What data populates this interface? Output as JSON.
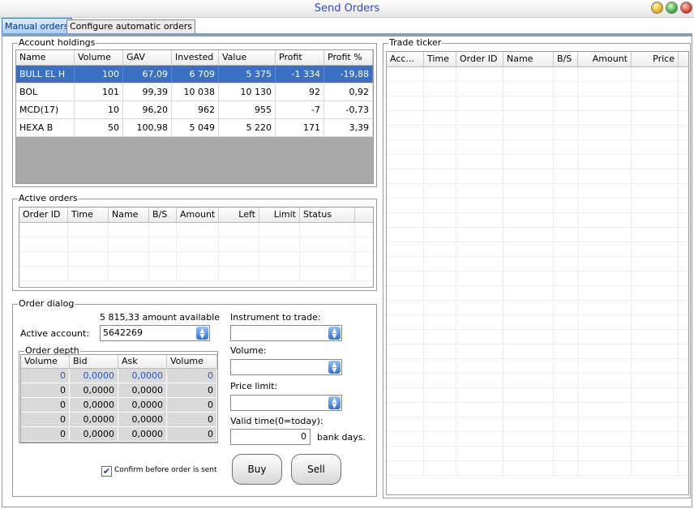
{
  "window": {
    "title": "Send Orders"
  },
  "tabs": [
    {
      "label": "Manual orders",
      "active": true
    },
    {
      "label": "Configure automatic orders",
      "active": false
    }
  ],
  "holdings": {
    "legend": "Account holdings",
    "columns": [
      "Name",
      "Volume",
      "GAV",
      "Invested",
      "Value",
      "Profit",
      "Profit %"
    ],
    "rows": [
      [
        "BULL EL H",
        "100",
        "67,09",
        "6 709",
        "5 375",
        "-1 334",
        "-19,88"
      ],
      [
        "BOL",
        "101",
        "99,39",
        "10 038",
        "10 130",
        "92",
        "0,92"
      ],
      [
        "MCD(17)",
        "10",
        "96,20",
        "962",
        "955",
        "-7",
        "-0,73"
      ],
      [
        "HEXA B",
        "50",
        "100,98",
        "5 049",
        "5 220",
        "171",
        "3,39"
      ]
    ],
    "selected_row": 0
  },
  "active_orders": {
    "legend": "Active orders",
    "columns": [
      "Order ID",
      "Time",
      "Name",
      "B/S",
      "Amount",
      "Left",
      "Limit",
      "Status"
    ]
  },
  "order_dialog": {
    "legend": "Order dialog",
    "available_text": "5 815,33 amount available",
    "account_label": "Active account:",
    "account_value": "5642269",
    "instrument_label": "Instrument to trade:",
    "instrument_value": "",
    "volume_label": "Volume:",
    "volume_value": "",
    "price_limit_label": "Price limit:",
    "price_limit_value": "",
    "valid_time_label": "Valid time(0=today):",
    "valid_time_value": "0",
    "bank_days_label": "bank days.",
    "confirm_label": "Confirm before order is sent",
    "confirm_checked": true,
    "buy_label": "Buy",
    "sell_label": "Sell",
    "depth": {
      "legend": "Order depth",
      "columns": [
        "Volume",
        "Bid",
        "Ask",
        "Volume"
      ],
      "rows": [
        [
          "0",
          "0,0000",
          "0,0000",
          "0"
        ],
        [
          "0",
          "0,0000",
          "0,0000",
          "0"
        ],
        [
          "0",
          "0,0000",
          "0,0000",
          "0"
        ],
        [
          "0",
          "0,0000",
          "0,0000",
          "0"
        ],
        [
          "0",
          "0,0000",
          "0,0000",
          "0"
        ]
      ]
    }
  },
  "trade_ticker": {
    "legend": "Trade ticker",
    "columns": [
      "Acc...",
      "Time",
      "Order ID",
      "Name",
      "B/S",
      "Amount",
      "Price"
    ]
  },
  "colors": {
    "selection": "#3a6fc4",
    "title": "#2b48d8",
    "accent": "#6ea3e0"
  }
}
